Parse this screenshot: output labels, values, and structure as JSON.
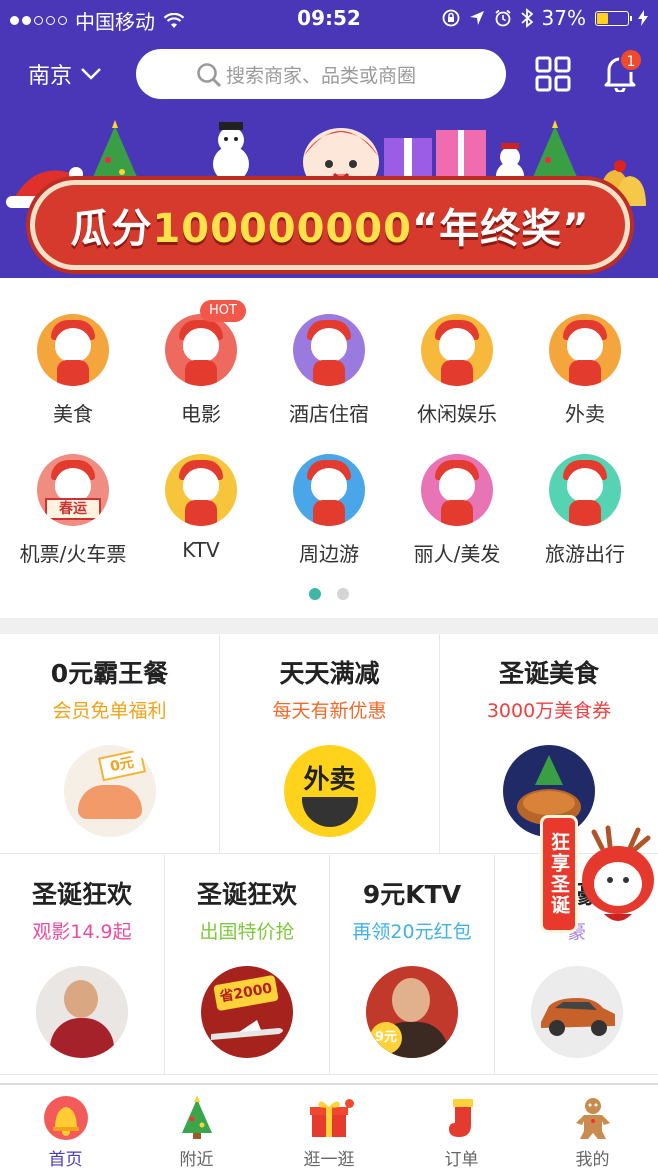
{
  "status_bar": {
    "carrier": "中国移动",
    "time": "09:52",
    "battery": "37%",
    "battery_level": 0.37,
    "signal_bars": 2
  },
  "header": {
    "city": "南京",
    "search_placeholder": "搜索商家、品类或商圈",
    "notification_count": "1"
  },
  "banner": {
    "text_prefix": "瓜分",
    "text_number": "100000000",
    "text_suffix": "“年终奖”"
  },
  "categories": [
    {
      "label": "美食",
      "icon": "food-icon",
      "color": "#f4a63c"
    },
    {
      "label": "电影",
      "icon": "movie-icon",
      "color": "#ef6a5e",
      "badge": "HOT"
    },
    {
      "label": "酒店住宿",
      "icon": "hotel-icon",
      "color": "#9b7ae0"
    },
    {
      "label": "休闲娱乐",
      "icon": "leisure-icon",
      "color": "#f6b93b"
    },
    {
      "label": "外卖",
      "icon": "takeout-icon",
      "color": "#f4a63c"
    },
    {
      "label": "机票/火车票",
      "icon": "ticket-icon",
      "color": "#f08d80"
    },
    {
      "label": "KTV",
      "icon": "ktv-icon",
      "color": "#f6c53c"
    },
    {
      "label": "周边游",
      "icon": "nearby-tour-icon",
      "color": "#4aa6e8"
    },
    {
      "label": "丽人/美发",
      "icon": "beauty-icon",
      "color": "#e873b5"
    },
    {
      "label": "旅游出行",
      "icon": "travel-icon",
      "color": "#56d3b3"
    }
  ],
  "ticket_badge": "春运",
  "pager": {
    "pages": 2,
    "current": 1
  },
  "promos_row1": [
    {
      "title": "0元霸王餐",
      "subtitle": "会员免单福利",
      "color": "#f0a318",
      "img": "free-meal-icon",
      "img_text": "0元"
    },
    {
      "title": "天天满减",
      "subtitle": "每天有新优惠",
      "color": "#f26a2a",
      "img": "takeout-discount-icon",
      "img_text": "外卖"
    },
    {
      "title": "圣诞美食",
      "subtitle": "3000万美食券",
      "color": "#ef3f3f",
      "img": "christmas-food-icon"
    }
  ],
  "promos_row2": [
    {
      "title": "圣诞狂欢",
      "subtitle": "观影14.9起",
      "color": "#ee4a9e",
      "img": "movie-star-icon"
    },
    {
      "title": "圣诞狂欢",
      "subtitle": "出国特价抢",
      "color": "#7fc93c",
      "img": "flight-deal-icon",
      "img_text": "省2000"
    },
    {
      "title": "9元KTV",
      "subtitle": "再领20元红包",
      "color": "#3fb2e8",
      "img": "ktv-singer-icon",
      "img_text": "9元"
    },
    {
      "title": "帝豪",
      "subtitle": "豪",
      "color": "#a77de0",
      "img": "car-icon"
    }
  ],
  "float_tag": "狂享圣诞",
  "tabs": [
    {
      "label": "首页",
      "icon": "home-bell-icon",
      "active": true
    },
    {
      "label": "附近",
      "icon": "nearby-tree-icon",
      "active": false
    },
    {
      "label": "逛一逛",
      "icon": "gift-icon",
      "active": false,
      "dot": true
    },
    {
      "label": "订单",
      "icon": "order-stocking-icon",
      "active": false
    },
    {
      "label": "我的",
      "icon": "profile-gingerbread-icon",
      "active": false
    }
  ]
}
